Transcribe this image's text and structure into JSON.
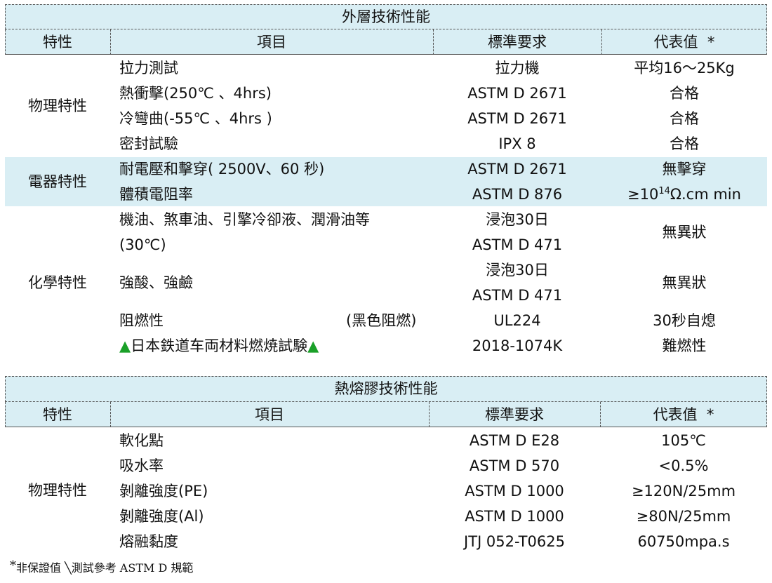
{
  "table1": {
    "title": "外層技術性能",
    "headers": [
      "特性",
      "項目",
      "標準要求",
      "代表值",
      "*"
    ],
    "groups": {
      "physical": "物理特性",
      "electrical": "電器特性",
      "chemical": "化學特性"
    },
    "rows": [
      {
        "item": "拉力測試",
        "standard": "拉力機",
        "value": "平均16～25Kg"
      },
      {
        "item": "熱衝擊(250℃ 、4hrs)",
        "standard": "ASTM D 2671",
        "value": "合格"
      },
      {
        "item": "冷彎曲(-55℃ 、4hrs )",
        "standard": "ASTM D 2671",
        "value": "合格"
      },
      {
        "item": "密封試驗",
        "standard": "IPX 8",
        "value": "合格"
      },
      {
        "item": "耐電壓和擊穿( 2500V、60  秒)",
        "standard": "ASTM D 2671",
        "value": "無擊穿"
      },
      {
        "item": "體積電阻率",
        "standard": "ASTM D 876",
        "value_prefix": "≥10",
        "value_sup": "14",
        "value_suffix": "Ω.cm min"
      },
      {
        "item_line1": "機油、煞車油、引擎冷卻液、潤滑油等",
        "item_line2": "(30℃)",
        "standard_line1": "浸泡30日",
        "standard_line2": "ASTM D 471",
        "value": "無異狀"
      },
      {
        "item": "強酸、強鹼",
        "standard_line1": "浸泡30日",
        "standard_line2": "ASTM D 471",
        "value": "無異狀"
      },
      {
        "item": "阻燃性",
        "item_note": "(黑色阻燃)",
        "standard": "UL224",
        "value": "30秒自熄"
      },
      {
        "item_prefix": "▲",
        "item": "日本鉄道车両材料燃焼試験",
        "item_suffix": "▲",
        "standard": "2018-1074K",
        "value": "難燃性"
      }
    ]
  },
  "table2": {
    "title": "熱熔膠技術性能",
    "headers": [
      "特性",
      "項目",
      "標準要求",
      "代表值",
      "*"
    ],
    "group": "物理特性",
    "rows": [
      {
        "item": "軟化點",
        "standard": "ASTM D E28",
        "value": "105℃"
      },
      {
        "item": "吸水率",
        "standard": "ASTM D 570",
        "value": "<0.5%"
      },
      {
        "item": "剝離強度(PE)",
        "standard": "ASTM D 1000",
        "value": "≥120N/25mm"
      },
      {
        "item": "剝離強度(Al)",
        "standard": "ASTM D 1000",
        "value": "≥80N/25mm"
      },
      {
        "item": "熔融黏度",
        "standard": "JTJ 052-T0625",
        "value": "60750mpa.s"
      }
    ]
  },
  "footnote": {
    "asterisk": "*",
    "text": "非保證值 ╲測試參考 ASTM D 規範"
  },
  "colors": {
    "header_band": "#d9eef4",
    "triangle": "#1aa028"
  }
}
